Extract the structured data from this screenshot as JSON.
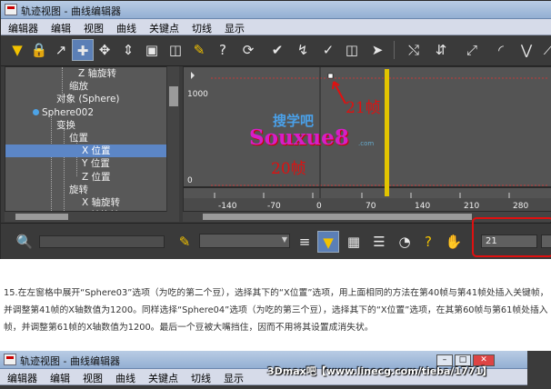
{
  "window": {
    "title": "轨迹视图 - 曲线编辑器",
    "menu": [
      "编辑器",
      "编辑",
      "视图",
      "曲线",
      "关键点",
      "切线",
      "显示"
    ]
  },
  "tree": {
    "items": [
      {
        "label": "Z 轴旋转",
        "indent": 80,
        "selected": false
      },
      {
        "label": "缩放",
        "indent": 70,
        "selected": false
      },
      {
        "label": "对象 (Sphere)",
        "indent": 56,
        "selected": false
      },
      {
        "label": "Sphere002",
        "indent": 44,
        "selected": false
      },
      {
        "label": "变换",
        "indent": 56,
        "selected": false
      },
      {
        "label": "位置",
        "indent": 70,
        "selected": false
      },
      {
        "label": "X 位置",
        "indent": 84,
        "selected": true
      },
      {
        "label": "Y 位置",
        "indent": 84,
        "selected": false
      },
      {
        "label": "Z 位置",
        "indent": 84,
        "selected": false
      },
      {
        "label": "旋转",
        "indent": 70,
        "selected": false
      },
      {
        "label": "X 轴旋转",
        "indent": 84,
        "selected": false
      },
      {
        "label": "Y 轴旋转",
        "indent": 84,
        "selected": false
      }
    ]
  },
  "curve": {
    "y_labels": [
      "1000",
      "0"
    ],
    "x_ticks": [
      "-140",
      "-70",
      "0",
      "70",
      "140",
      "210",
      "280"
    ],
    "annotation_top": "21帧",
    "annotation_bottom": "20帧",
    "logo_top": "搜学吧",
    "logo_main": "Souxue8",
    "logo_small": ".com"
  },
  "status": {
    "frame_value": "21"
  },
  "paragraph": "15.在左窗格中展开“Sphere03”选项（为吃的第二个豆），选择其下的“X位置”选项，用上面相同的方法在第40帧与第41帧处插入关键帧，并调整第41帧的X轴数值为1200。同样选择“Sphere04”选项（为吃的第三个豆），选择其下的“X位置”选项，在其第60帧与第61帧处插入帧，并调整第61帧的X轴数值为1200。最后一个豆被大嘴挡住，因而不用将其设置成消失状。",
  "window2": {
    "title": "轨迹视图 - 曲线编辑器",
    "menu": [
      "编辑器",
      "编辑",
      "视图",
      "曲线",
      "关键点",
      "切线",
      "显示"
    ],
    "watermark": "3Dmax吧【www.linecg.com/tieba/1771】"
  },
  "colors": {
    "panel_bg": "#3a3a3a",
    "selection": "#5c86c6",
    "time_line": "#e2c400",
    "annotation": "#e01010"
  },
  "icons": [
    "filter-icon",
    "lock-icon",
    "snap-icon",
    "move-keys-icon",
    "slide-icon",
    "scale-keys-icon",
    "scale-values-icon",
    "add-keys-icon",
    "draw-curves-icon",
    "reduce-keys-icon",
    "select-icon",
    "tangent-auto-icon",
    "tangent-spline-icon",
    "tangent-fast-icon",
    "tangent-slow-icon"
  ]
}
